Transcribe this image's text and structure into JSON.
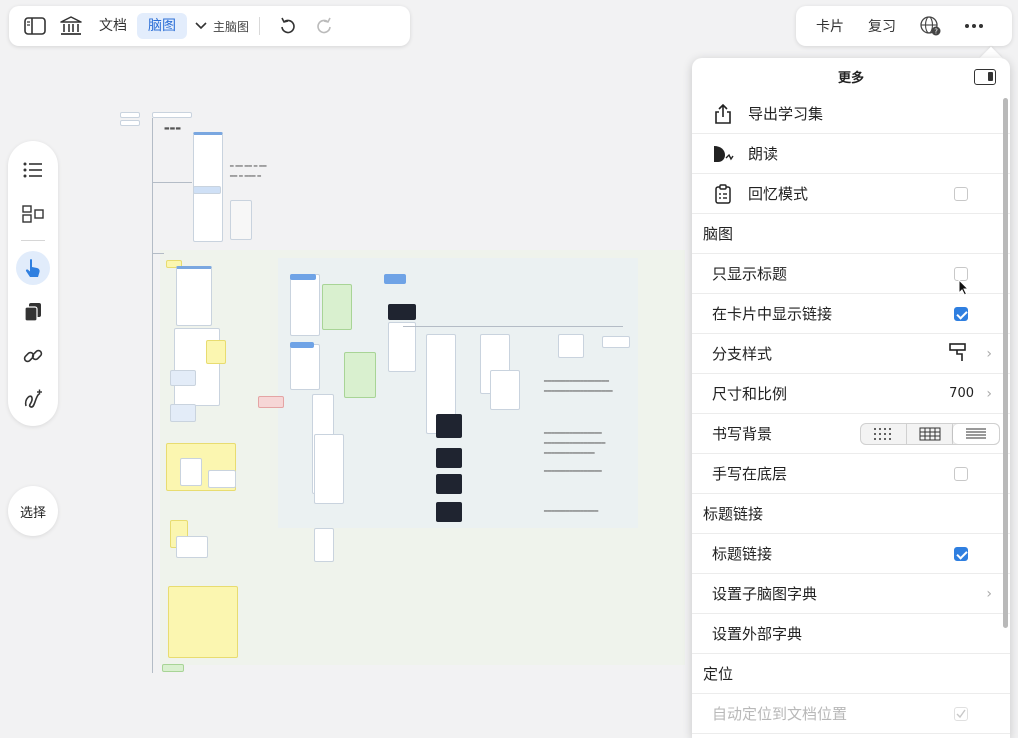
{
  "toolbar": {
    "doc_label": "文档",
    "mindmap_label": "脑图",
    "main_mindmap_label": "主脑图"
  },
  "toolbar_right": {
    "card_label": "卡片",
    "review_label": "复习"
  },
  "left": {
    "select_label": "选择"
  },
  "panel": {
    "title": "更多",
    "export_label": "导出学习集",
    "read_aloud_label": "朗读",
    "recall_label": "回忆模式",
    "section_mindmap": "脑图",
    "only_titles_label": "只显示标题",
    "show_links_label": "在卡片中显示链接",
    "branch_style_label": "分支样式",
    "size_ratio_label": "尺寸和比例",
    "size_ratio_value": "700",
    "writing_bg_label": "书写背景",
    "handwriting_bottom_label": "手写在底层",
    "section_title_link": "标题链接",
    "title_link_label": "标题链接",
    "child_dict_label": "设置子脑图字典",
    "external_dict_label": "设置外部字典",
    "section_locate": "定位",
    "auto_locate_label": "自动定位到文档位置"
  },
  "state": {
    "recall_mode": false,
    "only_titles": false,
    "show_links": true,
    "handwriting_bottom": false,
    "title_link": true,
    "auto_locate": true,
    "writing_bg_selected": "lines"
  },
  "colors": {
    "accent": "#2f7fe0",
    "active_bg": "#e3edfc"
  }
}
